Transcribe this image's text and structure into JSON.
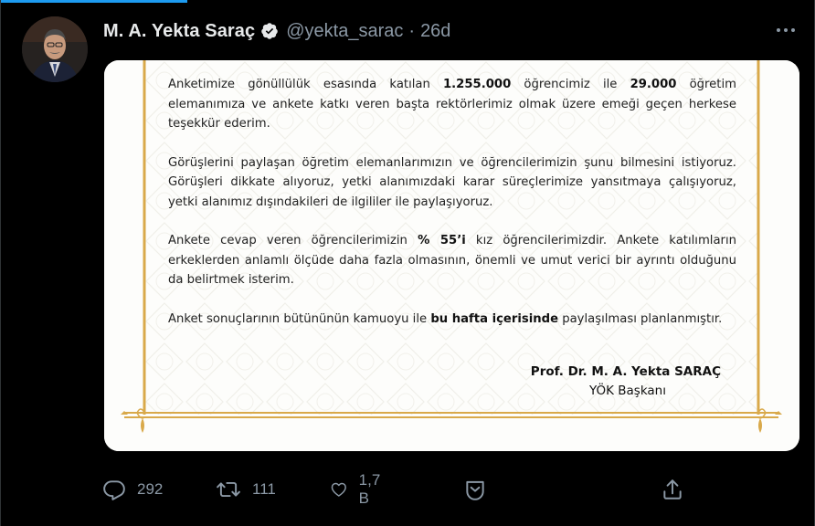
{
  "tweet": {
    "display_name": "M. A. Yekta Saraç",
    "handle": "@yekta_sarac",
    "separator": "·",
    "time": "26d",
    "verified": true
  },
  "image_text": {
    "p1_a": "Anketimize gönüllülük esasında katılan ",
    "p1_b": "1.255.000",
    "p1_c": " öğrencimiz ile ",
    "p1_d": "29.000",
    "p1_e": " öğretim elemanımıza ve ankete katkı veren başta rektörlerimiz olmak üzere emeği geçen herkese teşekkür ederim.",
    "p2": "Görüşlerini paylaşan öğretim elemanlarımızın ve öğrencilerimizin şunu bilmesini istiyoruz. Görüşleri dikkate alıyoruz, yetki alanımızdaki karar süreçlerimize yansıtmaya çalışıyoruz, yetki alanımız dışındakileri de ilgililer ile paylaşıyoruz.",
    "p3_a": "Ankete cevap veren öğrencilerimizin ",
    "p3_b": "% 55’i",
    "p3_c": " kız öğrencilerimizdir. Ankete katılımların erkeklerden anlamlı ölçüde daha fazla olmasının, önemli ve umut verici bir ayrıntı olduğunu da belirtmek isterim.",
    "p4_a": "Anket sonuçlarının bütününün kamuoyu ile ",
    "p4_b": "bu hafta içerisinde",
    "p4_c": " paylaşılması planlanmıştır.",
    "signature_name": "Prof. Dr. M. A. Yekta SARAÇ",
    "signature_title": "YÖK Başkanı"
  },
  "actions": {
    "reply_count": "292",
    "retweet_count": "111",
    "like_count": "1,7 B"
  },
  "icons": {
    "verified": "verified-badge-icon",
    "more": "more-dots-icon",
    "reply": "reply-icon",
    "retweet": "retweet-icon",
    "like": "heart-icon",
    "bookmark": "bookmark-icon",
    "share": "share-icon"
  },
  "colors": {
    "background": "#000000",
    "text_primary": "#e7e9ea",
    "text_secondary": "#8b98a5",
    "accent": "#1d9bf0",
    "frame_gold": "#d9a94a"
  }
}
